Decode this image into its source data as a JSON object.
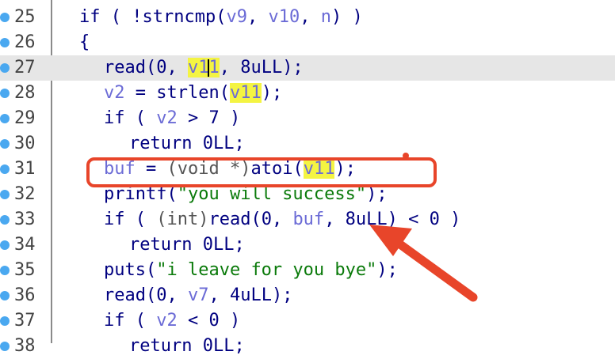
{
  "editor": {
    "lines": [
      {
        "num": "25",
        "segments": [
          {
            "t": "if ( !",
            "c": "c-kw"
          },
          {
            "t": "strncmp",
            "c": "c-fn"
          },
          {
            "t": "(",
            "c": "c-kw"
          },
          {
            "t": "v9",
            "c": "c-var"
          },
          {
            "t": ", ",
            "c": "c-kw"
          },
          {
            "t": "v10",
            "c": "c-var"
          },
          {
            "t": ", ",
            "c": "c-kw"
          },
          {
            "t": "n",
            "c": "c-var"
          },
          {
            "t": ") )",
            "c": "c-kw"
          }
        ]
      },
      {
        "num": "26",
        "segments": [
          {
            "t": "{",
            "c": "c-kw"
          }
        ]
      },
      {
        "num": "27",
        "segments": [
          {
            "t": "read",
            "c": "c-fn"
          },
          {
            "t": "(0, ",
            "c": "c-kw"
          },
          {
            "t": "v11",
            "c": "c-hlv",
            "caret": 2
          },
          {
            "t": ", 8uLL);",
            "c": "c-kw"
          }
        ]
      },
      {
        "num": "28",
        "segments": [
          {
            "t": "v2",
            "c": "c-var"
          },
          {
            "t": " = ",
            "c": "c-kw"
          },
          {
            "t": "strlen",
            "c": "c-fn"
          },
          {
            "t": "(",
            "c": "c-kw"
          },
          {
            "t": "v11",
            "c": "c-hlv"
          },
          {
            "t": ");",
            "c": "c-kw"
          }
        ]
      },
      {
        "num": "29",
        "segments": [
          {
            "t": "if ( ",
            "c": "c-kw"
          },
          {
            "t": "v2",
            "c": "c-var"
          },
          {
            "t": " > 7 )",
            "c": "c-kw"
          }
        ]
      },
      {
        "num": "30",
        "segments": [
          {
            "t": "return 0LL;",
            "c": "c-kw"
          }
        ]
      },
      {
        "num": "31",
        "segments": [
          {
            "t": "buf",
            "c": "c-var"
          },
          {
            "t": " = ",
            "c": "c-kw"
          },
          {
            "t": "(void *)",
            "c": "c-type"
          },
          {
            "t": "atoi",
            "c": "c-fn"
          },
          {
            "t": "(",
            "c": "c-kw"
          },
          {
            "t": "v11",
            "c": "c-hlv"
          },
          {
            "t": ");",
            "c": "c-kw"
          }
        ]
      },
      {
        "num": "32",
        "segments": [
          {
            "t": "printf",
            "c": "c-fn"
          },
          {
            "t": "(",
            "c": "c-kw"
          },
          {
            "t": "\"you will success\"",
            "c": "c-str"
          },
          {
            "t": ");",
            "c": "c-kw"
          }
        ]
      },
      {
        "num": "33",
        "segments": [
          {
            "t": "if ( ",
            "c": "c-kw"
          },
          {
            "t": "(int)",
            "c": "c-type"
          },
          {
            "t": "read",
            "c": "c-fn"
          },
          {
            "t": "(0, ",
            "c": "c-kw"
          },
          {
            "t": "buf",
            "c": "c-var"
          },
          {
            "t": ", 8uLL) < 0 )",
            "c": "c-kw"
          }
        ]
      },
      {
        "num": "34",
        "segments": [
          {
            "t": "return 0LL;",
            "c": "c-kw"
          }
        ]
      },
      {
        "num": "35",
        "segments": [
          {
            "t": "puts",
            "c": "c-fn"
          },
          {
            "t": "(",
            "c": "c-kw"
          },
          {
            "t": "\"i leave for you bye\"",
            "c": "c-str"
          },
          {
            "t": ");",
            "c": "c-kw"
          }
        ]
      },
      {
        "num": "36",
        "segments": [
          {
            "t": "read",
            "c": "c-fn"
          },
          {
            "t": "(0, ",
            "c": "c-kw"
          },
          {
            "t": "v7",
            "c": "c-var"
          },
          {
            "t": ", 4uLL);",
            "c": "c-kw"
          }
        ]
      },
      {
        "num": "37",
        "segments": [
          {
            "t": "if ( ",
            "c": "c-kw"
          },
          {
            "t": "v2",
            "c": "c-var"
          },
          {
            "t": " < 0 )",
            "c": "c-kw"
          }
        ]
      },
      {
        "num": "38",
        "segments": [
          {
            "t": "return 0LL;",
            "c": "c-kw"
          }
        ]
      }
    ]
  },
  "annotation": {
    "color": "#e8452a"
  }
}
